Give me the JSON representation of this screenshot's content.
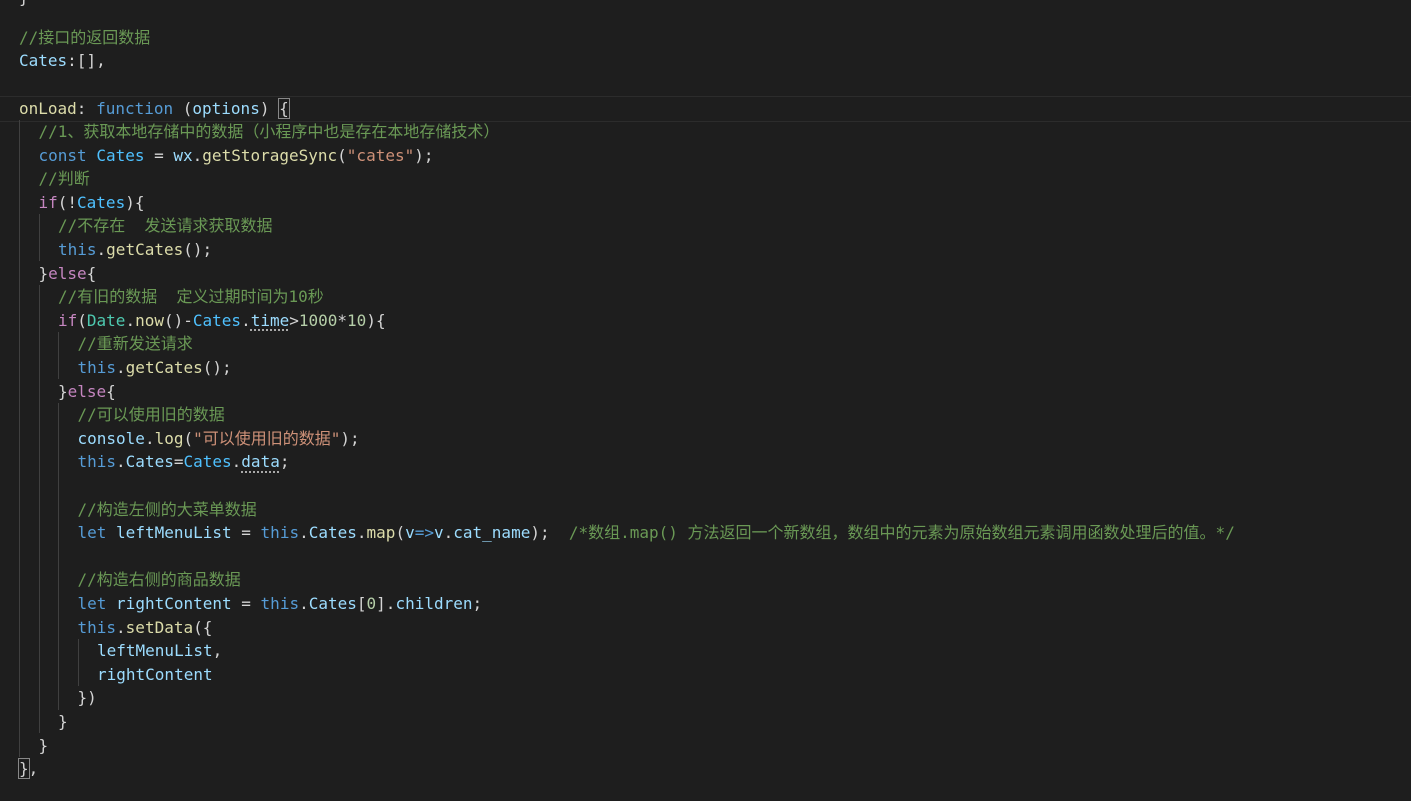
{
  "editor": {
    "top_fragment": "}",
    "lines": [
      {
        "tokens": [
          {
            "t": "//接口的返回数据",
            "c": "comment"
          }
        ]
      },
      {
        "tokens": [
          {
            "t": "Cates",
            "c": "var"
          },
          {
            "t": ":[],",
            "c": "punct"
          }
        ]
      },
      {
        "tokens": []
      },
      {
        "current": true,
        "tokens": [
          {
            "t": "onLoad",
            "c": "func"
          },
          {
            "t": ": ",
            "c": "punct"
          },
          {
            "t": "function",
            "c": "keyword"
          },
          {
            "t": " (",
            "c": "punct"
          },
          {
            "t": "options",
            "c": "var"
          },
          {
            "t": ") ",
            "c": "punct"
          },
          {
            "t": "{",
            "c": "punct",
            "match": true
          }
        ]
      },
      {
        "indent": 1,
        "tokens": [
          {
            "t": "//1、获取本地存储中的数据（小程序中也是存在本地存储技术）",
            "c": "comment"
          }
        ]
      },
      {
        "indent": 1,
        "tokens": [
          {
            "t": "const",
            "c": "keyword"
          },
          {
            "t": " ",
            "c": "punct"
          },
          {
            "t": "Cates",
            "c": "const"
          },
          {
            "t": " = ",
            "c": "punct"
          },
          {
            "t": "wx",
            "c": "var"
          },
          {
            "t": ".",
            "c": "punct"
          },
          {
            "t": "getStorageSync",
            "c": "func"
          },
          {
            "t": "(",
            "c": "punct"
          },
          {
            "t": "\"cates\"",
            "c": "string"
          },
          {
            "t": ");",
            "c": "punct"
          }
        ]
      },
      {
        "indent": 1,
        "tokens": [
          {
            "t": "//判断",
            "c": "comment"
          }
        ]
      },
      {
        "indent": 1,
        "tokens": [
          {
            "t": "if",
            "c": "control"
          },
          {
            "t": "(!",
            "c": "punct"
          },
          {
            "t": "Cates",
            "c": "const"
          },
          {
            "t": "){",
            "c": "punct"
          }
        ]
      },
      {
        "indent": 2,
        "tokens": [
          {
            "t": "//不存在  发送请求获取数据",
            "c": "comment"
          }
        ]
      },
      {
        "indent": 2,
        "tokens": [
          {
            "t": "this",
            "c": "keyword"
          },
          {
            "t": ".",
            "c": "punct"
          },
          {
            "t": "getCates",
            "c": "func"
          },
          {
            "t": "();",
            "c": "punct"
          }
        ]
      },
      {
        "indent": 1,
        "tokens": [
          {
            "t": "}",
            "c": "punct"
          },
          {
            "t": "else",
            "c": "control"
          },
          {
            "t": "{",
            "c": "punct"
          }
        ]
      },
      {
        "indent": 2,
        "tokens": [
          {
            "t": "//有旧的数据  定义过期时间为10秒",
            "c": "comment"
          }
        ]
      },
      {
        "indent": 2,
        "tokens": [
          {
            "t": "if",
            "c": "control"
          },
          {
            "t": "(",
            "c": "punct"
          },
          {
            "t": "Date",
            "c": "class"
          },
          {
            "t": ".",
            "c": "punct"
          },
          {
            "t": "now",
            "c": "func"
          },
          {
            "t": "()-",
            "c": "punct"
          },
          {
            "t": "Cates",
            "c": "const"
          },
          {
            "t": ".",
            "c": "punct"
          },
          {
            "t": "time",
            "c": "var",
            "dotted": true
          },
          {
            "t": ">",
            "c": "punct"
          },
          {
            "t": "1000",
            "c": "number"
          },
          {
            "t": "*",
            "c": "punct"
          },
          {
            "t": "10",
            "c": "number"
          },
          {
            "t": "){",
            "c": "punct"
          }
        ]
      },
      {
        "indent": 3,
        "tokens": [
          {
            "t": "//重新发送请求",
            "c": "comment"
          }
        ]
      },
      {
        "indent": 3,
        "tokens": [
          {
            "t": "this",
            "c": "keyword"
          },
          {
            "t": ".",
            "c": "punct"
          },
          {
            "t": "getCates",
            "c": "func"
          },
          {
            "t": "();",
            "c": "punct"
          }
        ]
      },
      {
        "indent": 2,
        "tokens": [
          {
            "t": "}",
            "c": "punct"
          },
          {
            "t": "else",
            "c": "control"
          },
          {
            "t": "{",
            "c": "punct"
          }
        ]
      },
      {
        "indent": 3,
        "tokens": [
          {
            "t": "//可以使用旧的数据",
            "c": "comment"
          }
        ]
      },
      {
        "indent": 3,
        "tokens": [
          {
            "t": "console",
            "c": "var"
          },
          {
            "t": ".",
            "c": "punct"
          },
          {
            "t": "log",
            "c": "func"
          },
          {
            "t": "(",
            "c": "punct"
          },
          {
            "t": "\"可以使用旧的数据\"",
            "c": "string"
          },
          {
            "t": ");",
            "c": "punct"
          }
        ]
      },
      {
        "indent": 3,
        "tokens": [
          {
            "t": "this",
            "c": "keyword"
          },
          {
            "t": ".",
            "c": "punct"
          },
          {
            "t": "Cates",
            "c": "var"
          },
          {
            "t": "=",
            "c": "punct"
          },
          {
            "t": "Cates",
            "c": "const"
          },
          {
            "t": ".",
            "c": "punct"
          },
          {
            "t": "data",
            "c": "var",
            "dotted": true
          },
          {
            "t": ";",
            "c": "punct"
          }
        ]
      },
      {
        "indent": 3,
        "tokens": []
      },
      {
        "indent": 3,
        "tokens": [
          {
            "t": "//构造左侧的大菜单数据",
            "c": "comment"
          }
        ]
      },
      {
        "indent": 3,
        "tokens": [
          {
            "t": "let",
            "c": "keyword"
          },
          {
            "t": " ",
            "c": "punct"
          },
          {
            "t": "leftMenuList",
            "c": "var"
          },
          {
            "t": " = ",
            "c": "punct"
          },
          {
            "t": "this",
            "c": "keyword"
          },
          {
            "t": ".",
            "c": "punct"
          },
          {
            "t": "Cates",
            "c": "var"
          },
          {
            "t": ".",
            "c": "punct"
          },
          {
            "t": "map",
            "c": "func"
          },
          {
            "t": "(",
            "c": "punct"
          },
          {
            "t": "v",
            "c": "var"
          },
          {
            "t": "=>",
            "c": "keyword"
          },
          {
            "t": "v",
            "c": "var"
          },
          {
            "t": ".",
            "c": "punct"
          },
          {
            "t": "cat_name",
            "c": "var"
          },
          {
            "t": ");  ",
            "c": "punct"
          },
          {
            "t": "/*数组.map() 方法返回一个新数组，数组中的元素为原始数组元素调用函数处理后的值。*/",
            "c": "comment"
          }
        ]
      },
      {
        "indent": 3,
        "tokens": []
      },
      {
        "indent": 3,
        "tokens": [
          {
            "t": "//构造右侧的商品数据",
            "c": "comment"
          }
        ]
      },
      {
        "indent": 3,
        "tokens": [
          {
            "t": "let",
            "c": "keyword"
          },
          {
            "t": " ",
            "c": "punct"
          },
          {
            "t": "rightContent",
            "c": "var"
          },
          {
            "t": " = ",
            "c": "punct"
          },
          {
            "t": "this",
            "c": "keyword"
          },
          {
            "t": ".",
            "c": "punct"
          },
          {
            "t": "Cates",
            "c": "var"
          },
          {
            "t": "[",
            "c": "punct"
          },
          {
            "t": "0",
            "c": "number"
          },
          {
            "t": "].",
            "c": "punct"
          },
          {
            "t": "children",
            "c": "var"
          },
          {
            "t": ";",
            "c": "punct"
          }
        ]
      },
      {
        "indent": 3,
        "tokens": [
          {
            "t": "this",
            "c": "keyword"
          },
          {
            "t": ".",
            "c": "punct"
          },
          {
            "t": "setData",
            "c": "func"
          },
          {
            "t": "({",
            "c": "punct"
          }
        ]
      },
      {
        "indent": 4,
        "tokens": [
          {
            "t": "leftMenuList",
            "c": "var"
          },
          {
            "t": ",",
            "c": "punct"
          }
        ]
      },
      {
        "indent": 4,
        "tokens": [
          {
            "t": "rightContent",
            "c": "var"
          }
        ]
      },
      {
        "indent": 3,
        "tokens": [
          {
            "t": "})",
            "c": "punct"
          }
        ]
      },
      {
        "indent": 2,
        "tokens": [
          {
            "t": "}",
            "c": "punct"
          }
        ]
      },
      {
        "indent": 1,
        "tokens": [
          {
            "t": "}",
            "c": "punct"
          }
        ]
      },
      {
        "tokens": [
          {
            "t": "}",
            "c": "punct",
            "match": true
          },
          {
            "t": ",",
            "c": "punct"
          }
        ]
      }
    ]
  }
}
